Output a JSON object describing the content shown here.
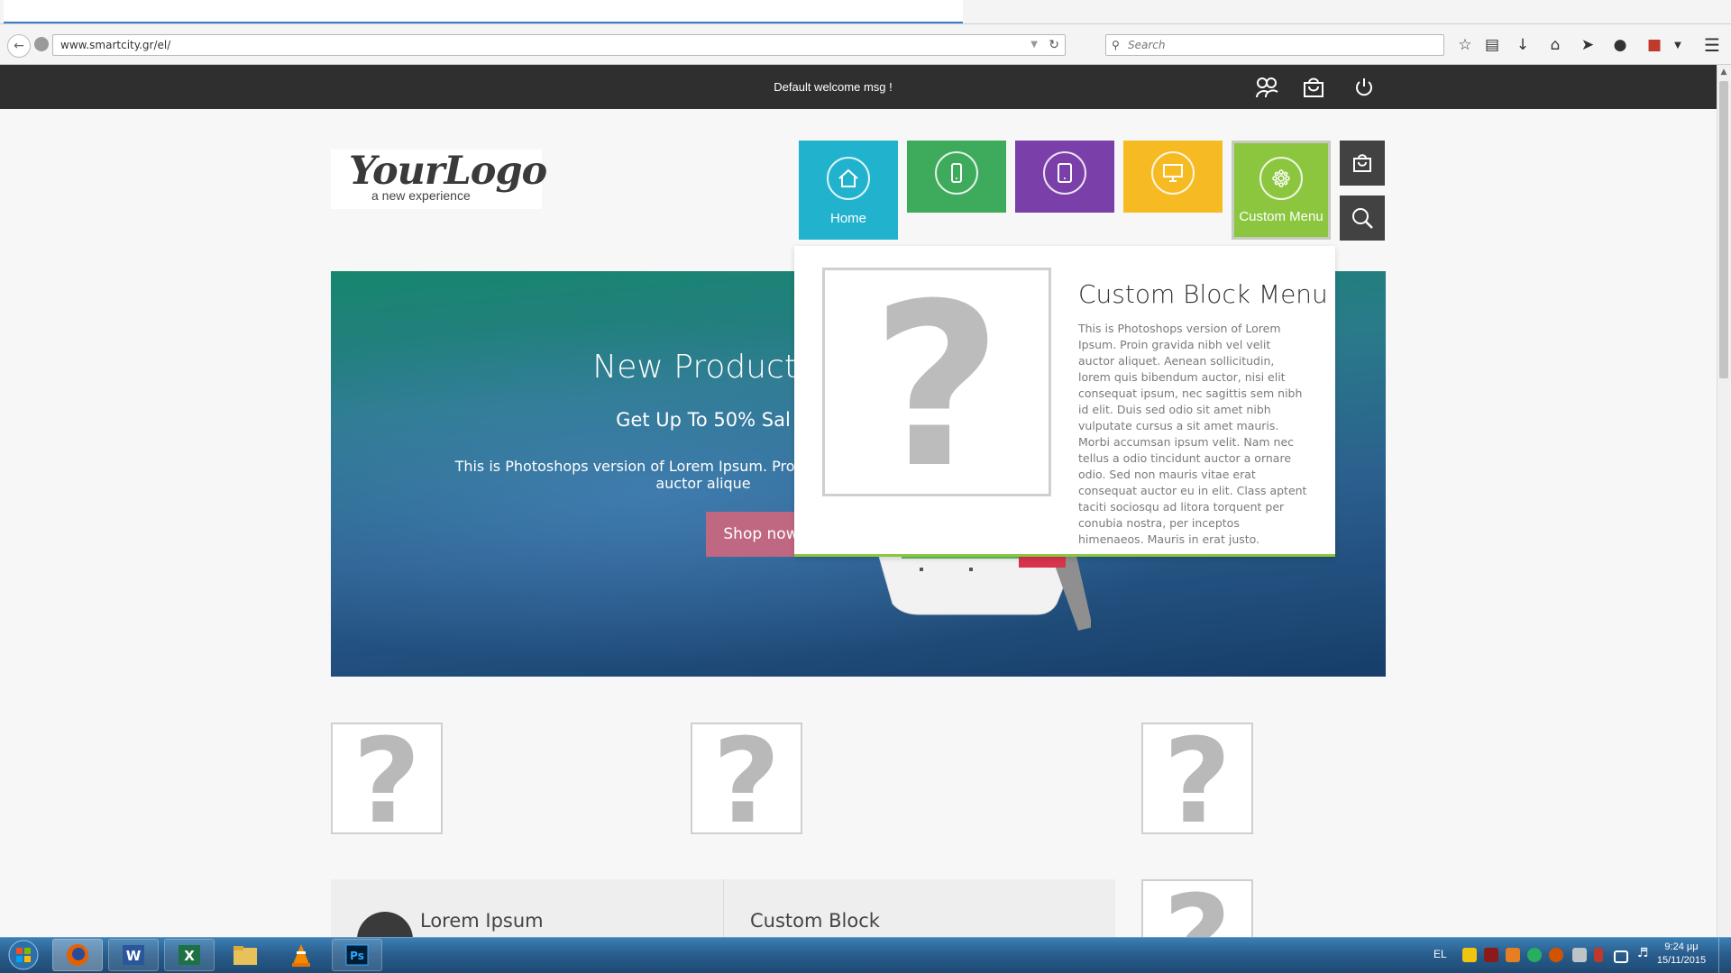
{
  "browser": {
    "url": "www.smartcity.gr/el/",
    "search_placeholder": "Search"
  },
  "topbar": {
    "welcome": "Default welcome msg !"
  },
  "logo": {
    "main": "YourLogo",
    "sub": "a new experience"
  },
  "menu": {
    "tiles": [
      {
        "label": "Home",
        "color": "#21b3cd",
        "icon": "home-icon"
      },
      {
        "label": "",
        "color": "#3eaa5c",
        "icon": "smartphone-icon"
      },
      {
        "label": "",
        "color": "#7a3fa8",
        "icon": "tablet-icon"
      },
      {
        "label": "",
        "color": "#f6bb22",
        "icon": "monitor-icon"
      },
      {
        "label": "Custom Menu",
        "color": "#8cc63f",
        "icon": "flower-icon"
      }
    ]
  },
  "hero": {
    "title": "New Products",
    "subtitle": "Get Up To 50% Sal",
    "description": "This is Photoshops version of Lorem Ipsum. Pro gravida nibh vel velit auctor alique",
    "button": "Shop now"
  },
  "dropdown": {
    "title": "Custom Block Menu",
    "text": "This is Photoshops version of Lorem Ipsum. Proin gravida nibh vel velit auctor aliquet. Aenean sollicitudin, lorem quis bibendum auctor, nisi elit consequat ipsum, nec sagittis sem nibh id elit. Duis sed odio sit amet nibh vulputate cursus a sit amet mauris. Morbi accumsan ipsum velit. Nam nec tellus a odio tincidunt auctor a ornare odio. Sed non mauris vitae erat consequat auctor eu in elit. Class aptent taciti sociosqu ad litora torquent per conubia nostra, per inceptos himenaeos. Mauris in erat justo."
  },
  "blocks": {
    "lorem_title": "Lorem Ipsum",
    "custom_title": "Custom Block"
  },
  "taskbar": {
    "language": "EL",
    "time": "9:24 μμ",
    "date": "15/11/2015"
  },
  "colors": {
    "topbar": "#2f2f2f",
    "accent_green": "#8cc63f",
    "shop_button": "#c06882"
  }
}
